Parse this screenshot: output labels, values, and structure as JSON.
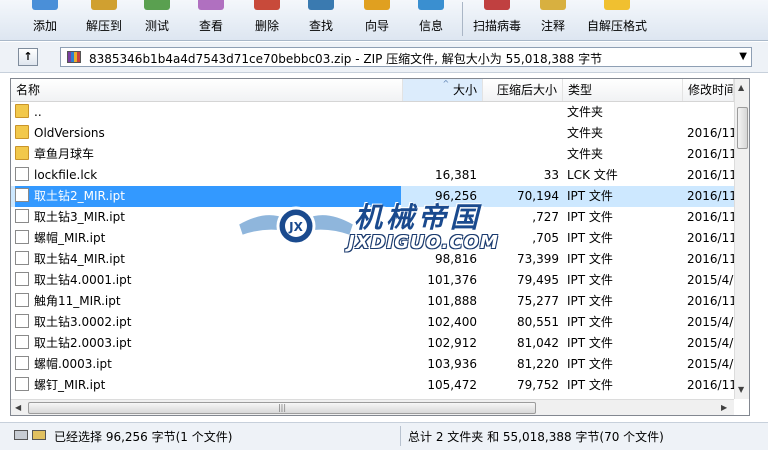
{
  "toolbar": {
    "buttons": [
      {
        "label": "添加",
        "color": "#4a8fd8"
      },
      {
        "label": "解压到",
        "color": "#d0a030"
      },
      {
        "label": "测试",
        "color": "#5aa050"
      },
      {
        "label": "查看",
        "color": "#b070c0"
      },
      {
        "label": "删除",
        "color": "#c84a3a"
      },
      {
        "label": "查找",
        "color": "#3a7ab0"
      },
      {
        "label": "向导",
        "color": "#e0a020"
      },
      {
        "label": "信息",
        "color": "#3a8fd0"
      },
      {
        "label": "扫描病毒",
        "color": "#c04040"
      },
      {
        "label": "注释",
        "color": "#d8b040"
      },
      {
        "label": "自解压格式",
        "color": "#f0c030"
      }
    ]
  },
  "path": {
    "text": "8385346b1b4a4d7543d71ce70bebbc03.zip - ZIP 压缩文件, 解包大小为 55,018,388 字节",
    "up_label": "↑"
  },
  "columns": {
    "name": "名称",
    "size": "大小",
    "packed": "压缩后大小",
    "type": "类型",
    "modified": "修改时间"
  },
  "files": [
    {
      "name": "..",
      "size": "",
      "packed": "",
      "type": "文件夹",
      "modified": "",
      "kind": "folder"
    },
    {
      "name": "OldVersions",
      "size": "",
      "packed": "",
      "type": "文件夹",
      "modified": "2016/11",
      "kind": "folder"
    },
    {
      "name": "章鱼月球车",
      "size": "",
      "packed": "",
      "type": "文件夹",
      "modified": "2016/11",
      "kind": "folder"
    },
    {
      "name": "lockfile.lck",
      "size": "16,381",
      "packed": "33",
      "type": "LCK 文件",
      "modified": "2016/11",
      "kind": "file"
    },
    {
      "name": "取土钻2_MIR.ipt",
      "size": "96,256",
      "packed": "70,194",
      "type": "IPT 文件",
      "modified": "2016/11",
      "kind": "file",
      "selected": true
    },
    {
      "name": "取土钻3_MIR.ipt",
      "size": "",
      "packed": ",727",
      "type": "IPT 文件",
      "modified": "2016/11",
      "kind": "file"
    },
    {
      "name": "螺帽_MIR.ipt",
      "size": "",
      "packed": ",705",
      "type": "IPT 文件",
      "modified": "2016/11",
      "kind": "file"
    },
    {
      "name": "取土钻4_MIR.ipt",
      "size": "98,816",
      "packed": "73,399",
      "type": "IPT 文件",
      "modified": "2016/11",
      "kind": "file"
    },
    {
      "name": "取土钻4.0001.ipt",
      "size": "101,376",
      "packed": "79,495",
      "type": "IPT 文件",
      "modified": "2015/4/",
      "kind": "file"
    },
    {
      "name": "触角11_MIR.ipt",
      "size": "101,888",
      "packed": "75,277",
      "type": "IPT 文件",
      "modified": "2016/11",
      "kind": "file"
    },
    {
      "name": "取土钻3.0002.ipt",
      "size": "102,400",
      "packed": "80,551",
      "type": "IPT 文件",
      "modified": "2015/4/",
      "kind": "file"
    },
    {
      "name": "取土钻2.0003.ipt",
      "size": "102,912",
      "packed": "81,042",
      "type": "IPT 文件",
      "modified": "2015/4/",
      "kind": "file"
    },
    {
      "name": "螺帽.0003.ipt",
      "size": "103,936",
      "packed": "81,220",
      "type": "IPT 文件",
      "modified": "2015/4/",
      "kind": "file"
    },
    {
      "name": "螺钉_MIR.ipt",
      "size": "105,472",
      "packed": "79,752",
      "type": "IPT 文件",
      "modified": "2016/11",
      "kind": "file"
    }
  ],
  "status": {
    "left": "已经选择 96,256 字节(1 个文件)",
    "right": "总计 2 文件夹 和 55,018,388 字节(70 个文件)"
  },
  "watermark": {
    "title": "机械帝国",
    "subtitle": "JXDIGUO.COM",
    "badge": "JX"
  },
  "scroll": {
    "up": "▲",
    "down": "▼",
    "left": "◀",
    "right": "▶",
    "grip": "|||"
  },
  "header_sort_arrow": "^"
}
